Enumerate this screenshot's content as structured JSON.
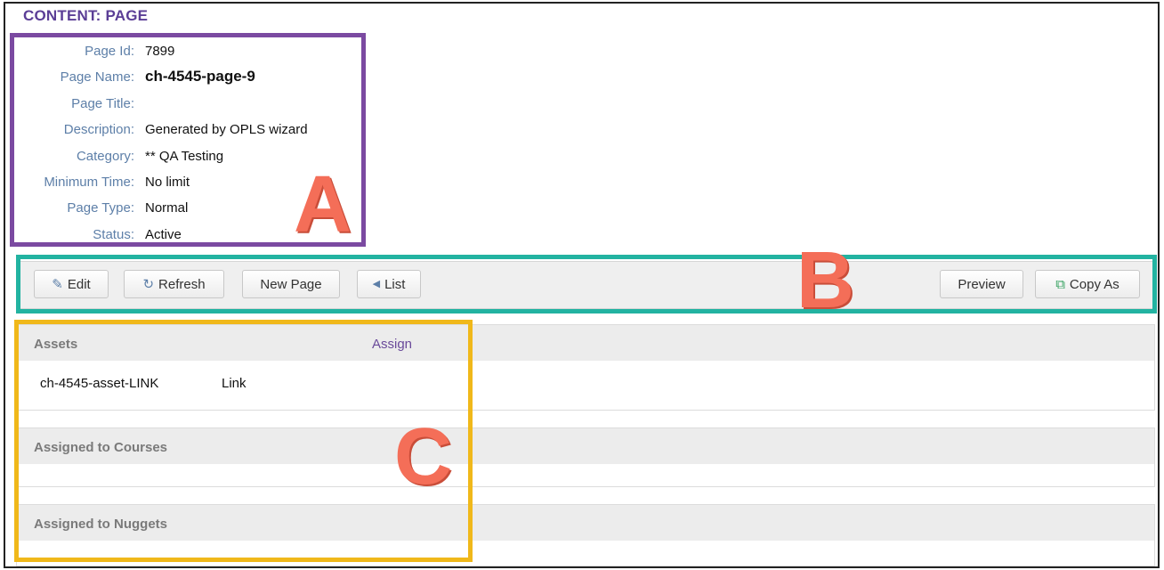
{
  "page_title": "CONTENT: PAGE",
  "details": [
    {
      "label": "Page Id:",
      "value": "7899",
      "bold": false
    },
    {
      "label": "Page Name:",
      "value": "ch-4545-page-9",
      "bold": true
    },
    {
      "label": "Page Title:",
      "value": "",
      "bold": false
    },
    {
      "label": "Description:",
      "value": "Generated by OPLS wizard",
      "bold": false
    },
    {
      "label": "Category:",
      "value": "** QA Testing",
      "bold": false
    },
    {
      "label": "Minimum Time:",
      "value": "No limit",
      "bold": false
    },
    {
      "label": "Page Type:",
      "value": "Normal",
      "bold": false
    },
    {
      "label": "Status:",
      "value": "Active",
      "bold": false
    }
  ],
  "toolbar": {
    "edit_label": "Edit",
    "refresh_label": "Refresh",
    "new_page_label": "New Page",
    "list_label": "List",
    "preview_label": "Preview",
    "copy_as_label": "Copy As"
  },
  "sections": {
    "assets": {
      "title": "Assets",
      "assign_label": "Assign",
      "rows": [
        {
          "name": "ch-4545-asset-LINK",
          "type": "Link"
        }
      ]
    },
    "courses": {
      "title": "Assigned to Courses"
    },
    "nuggets": {
      "title": "Assigned to Nuggets"
    }
  },
  "annotations": {
    "a": "A",
    "b": "B",
    "c": "C"
  },
  "colors": {
    "box_a": "#7b4aa1",
    "box_b": "#22b3a1",
    "box_c": "#f0b81a",
    "letters": "#f46e58",
    "header": "#5b3e96",
    "label": "#5d7fa8"
  },
  "icons": {
    "edit": "edit-icon",
    "refresh": "refresh-icon",
    "list": "caret-left-icon",
    "copy_as": "copy-icon"
  }
}
